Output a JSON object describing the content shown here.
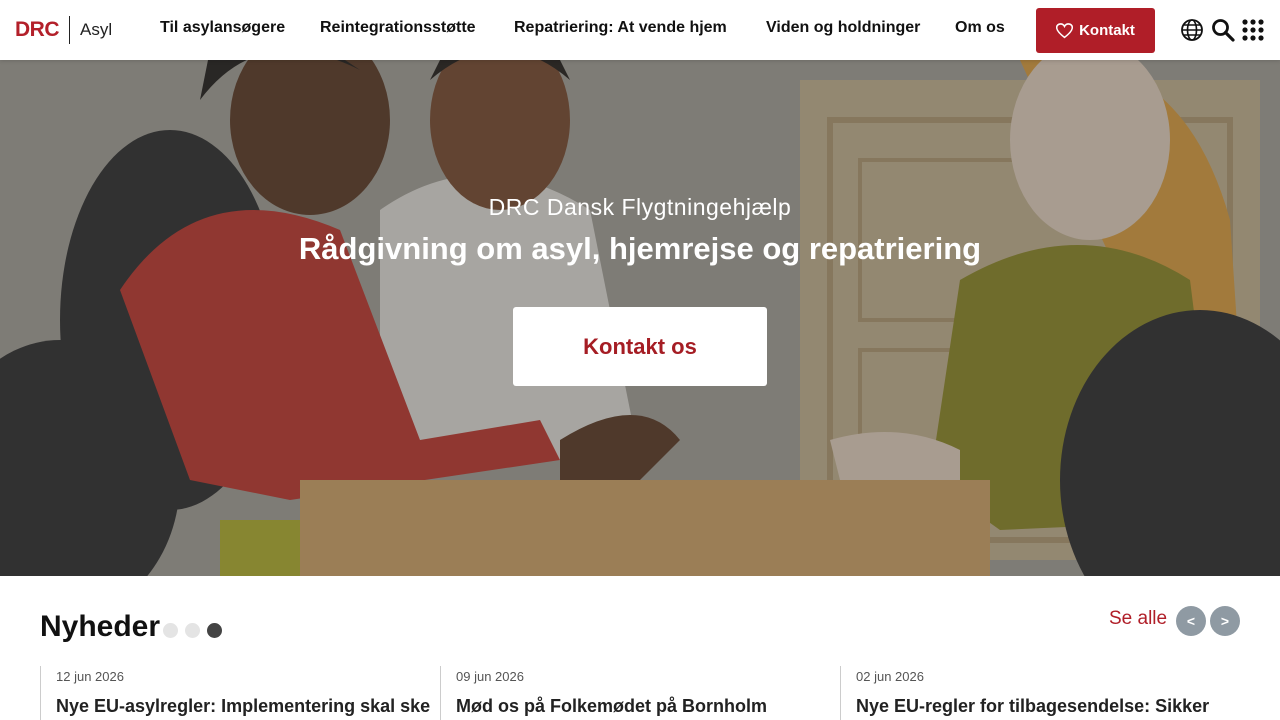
{
  "header": {
    "logo_mark": "DRC",
    "logo_text": "Asyl",
    "nav": [
      {
        "label": "Til asylansøgere"
      },
      {
        "label": "Reintegrationsstøtte"
      },
      {
        "label": "Repatriering: At vende hjem"
      },
      {
        "label": "Viden og holdninger"
      },
      {
        "label": "Om os"
      }
    ],
    "contact_label": "Kontakt",
    "icons": [
      "heart-icon",
      "globe-icon",
      "search-icon",
      "apps-grid-icon"
    ]
  },
  "hero": {
    "subtitle": "DRC Dansk Flygtningehjælp",
    "title": "Rådgivning om asyl, hjemrejse og repatriering",
    "cta_label": "Kontakt os"
  },
  "news": {
    "heading": "Nyheder",
    "see_all": "Se alle",
    "prev": "<",
    "next": ">",
    "active_dot": 3,
    "cards": [
      {
        "date": "12 jun 2026",
        "title": "Nye EU-asylregler: Implementering skal ske"
      },
      {
        "date": "09 jun 2026",
        "title": "Mød os på Folkemødet på Bornholm"
      },
      {
        "date": "02 jun 2026",
        "title": "Nye EU-regler for tilbagesendelse: Sikker"
      }
    ]
  },
  "colors": {
    "brand_red": "#b01e28",
    "arrow_gray": "#8f9aa3"
  }
}
